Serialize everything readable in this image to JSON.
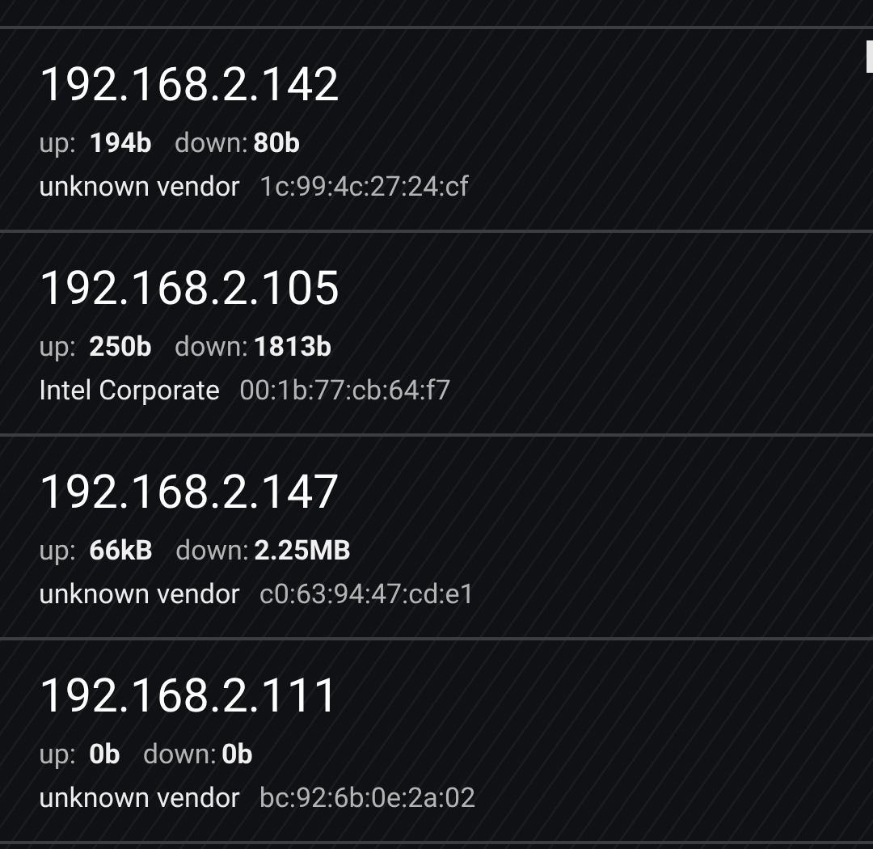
{
  "hosts": [
    {
      "ip": "192.168.2.142",
      "up_label": "up:",
      "up": "194b",
      "down_label": "down:",
      "down": "80b",
      "vendor": "unknown vendor",
      "mac": "1c:99:4c:27:24:cf"
    },
    {
      "ip": "192.168.2.105",
      "up_label": "up:",
      "up": "250b",
      "down_label": "down:",
      "down": "1813b",
      "vendor": "Intel Corporate",
      "mac": "00:1b:77:cb:64:f7"
    },
    {
      "ip": "192.168.2.147",
      "up_label": "up:",
      "up": "66kB",
      "down_label": "down:",
      "down": "2.25MB",
      "vendor": "unknown vendor",
      "mac": "c0:63:94:47:cd:e1"
    },
    {
      "ip": "192.168.2.111",
      "up_label": "up:",
      "up": "0b",
      "down_label": "down:",
      "down": "0b",
      "vendor": "unknown vendor",
      "mac": "bc:92:6b:0e:2a:02"
    }
  ]
}
